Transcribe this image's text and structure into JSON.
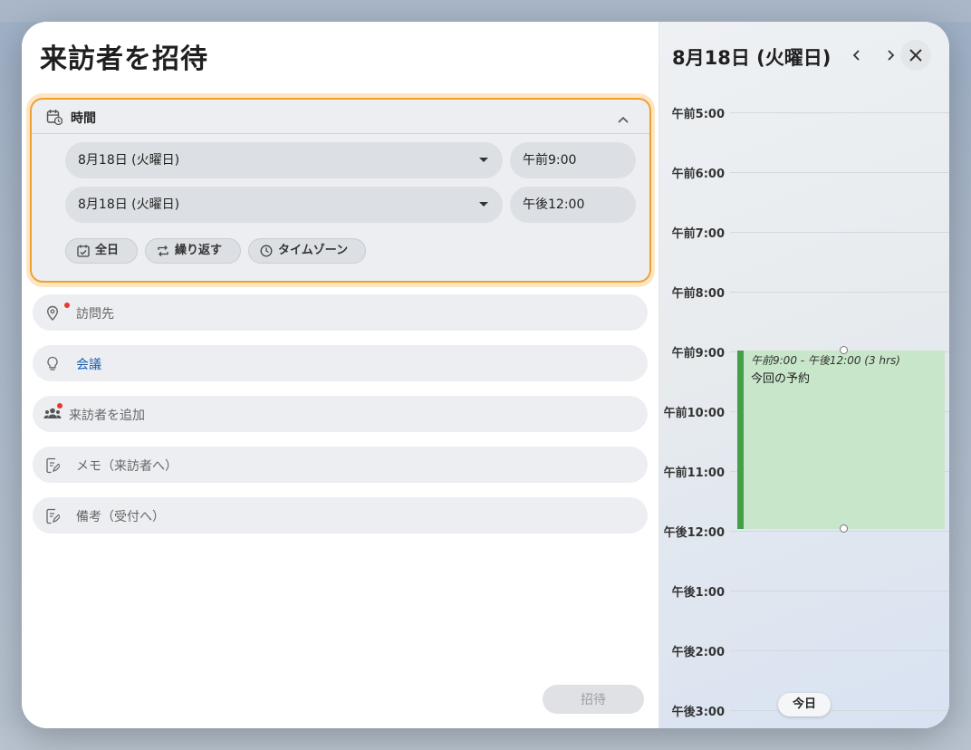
{
  "dialog": {
    "title": "来訪者を招待",
    "invite_button": "招待"
  },
  "time_section": {
    "label": "時間",
    "start_date": "8月18日 (火曜日)",
    "start_time": "午前9:00",
    "end_date": "8月18日 (火曜日)",
    "end_time": "午後12:00",
    "chips": {
      "all_day": "全日",
      "repeat": "繰り返す",
      "timezone": "タイムゾーン"
    }
  },
  "fields": {
    "location_placeholder": "訪問先",
    "meeting_type": "会議",
    "add_visitor_placeholder": "来訪者を追加",
    "memo_placeholder": "メモ（来訪者へ）",
    "notes_placeholder": "備考（受付へ）"
  },
  "calendar": {
    "date": "8月18日 (火曜日)",
    "hours": [
      "午前5:00",
      "午前6:00",
      "午前7:00",
      "午前8:00",
      "午前9:00",
      "午前10:00",
      "午前11:00",
      "午後12:00",
      "午後1:00",
      "午後2:00",
      "午後3:00"
    ],
    "event": {
      "time_range": "午前9:00 - 午後12:00 (3 hrs)",
      "title": "今回の予約",
      "color": "#c8e6c9",
      "accent": "#43a047"
    },
    "today_button": "今日"
  },
  "colors": {
    "focus_border": "#f0a030",
    "required_dot": "#e53935",
    "link_blue": "#1a5fb4"
  }
}
